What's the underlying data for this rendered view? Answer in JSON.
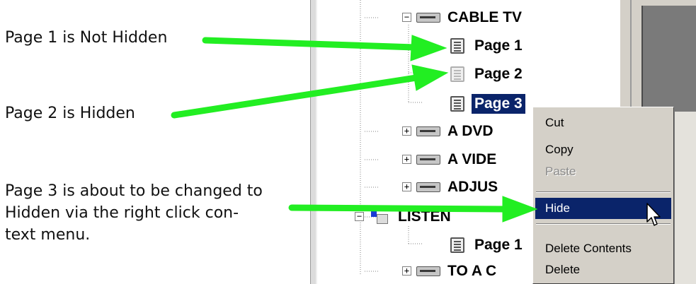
{
  "annotations": {
    "page1_note": "Page 1 is Not Hidden",
    "page2_note": "Page 2 is Hidden",
    "page3_note_line1": "Page 3 is about to be changed to",
    "page3_note_line2": "Hidden via the right click con-",
    "page3_note_line3": "text menu."
  },
  "tree": {
    "cable_tv": "CABLE TV",
    "page1": "Page 1",
    "page2": "Page 2",
    "page3": "Page 3",
    "a_dvd": "A DVD",
    "a_video": "A VIDE",
    "adjust": "ADJUS",
    "listen": "LISTEN",
    "listen_page1": "Page 1",
    "to_a": "TO A C",
    "collapse_symbol": "−",
    "expand_symbol": "+"
  },
  "context_menu": {
    "cut": "Cut",
    "copy": "Copy",
    "paste": "Paste",
    "hide": "Hide",
    "delete_contents": "Delete Contents",
    "delete": "Delete"
  },
  "colors": {
    "arrow": "#22ee22",
    "selection": "#0a246a",
    "menu_bg": "#d4d0c8"
  }
}
